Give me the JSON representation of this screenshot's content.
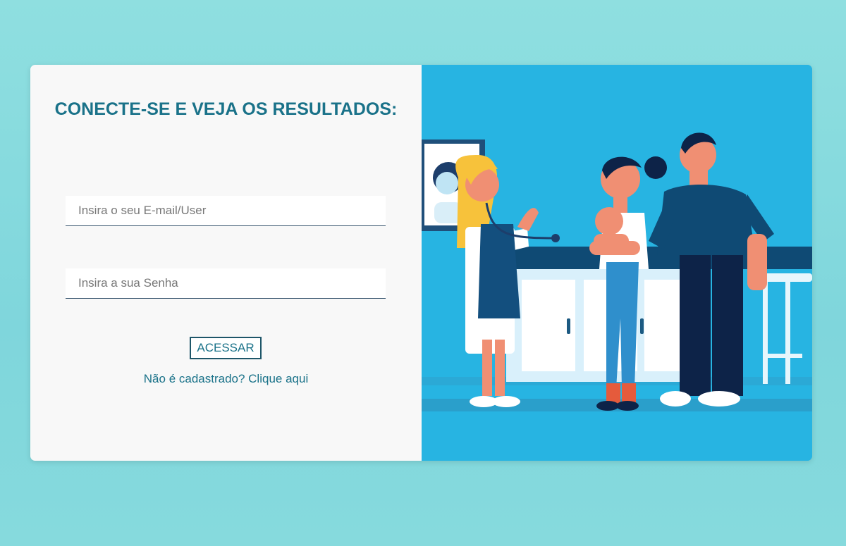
{
  "login": {
    "title": "CONECTE-SE E VEJA OS RESULTADOS:",
    "email_placeholder": "Insira o seu E-mail/User",
    "password_placeholder": "Insira a sua Senha",
    "submit_label": "ACESSAR",
    "register_link": "Não é cadastrado? Clique aqui"
  },
  "colors": {
    "page_background": "#86dadd",
    "card_left_background": "#f8f8f8",
    "accent_text": "#1a7289",
    "illustration_background": "#27b4e2"
  },
  "illustration": {
    "icon": "family-doctor-visit-illustration"
  }
}
